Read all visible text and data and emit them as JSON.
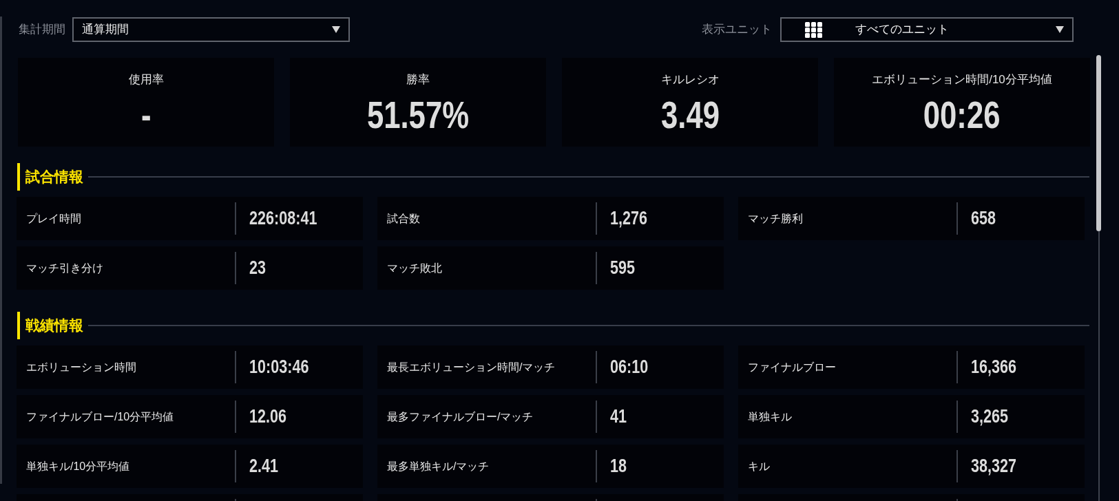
{
  "period_filter": {
    "label": "集計期間",
    "value": "通算期間"
  },
  "unit_filter": {
    "label": "表示ユニット",
    "value": "すべてのユニット"
  },
  "summary": [
    {
      "label": "使用率",
      "value": "-"
    },
    {
      "label": "勝率",
      "value": "51.57%"
    },
    {
      "label": "キルレシオ",
      "value": "3.49"
    },
    {
      "label": "エボリューション時間/10分平均値",
      "value": "00:26"
    }
  ],
  "sections": [
    {
      "title": "試合情報",
      "stats": [
        {
          "label": "プレイ時間",
          "value": "226:08:41"
        },
        {
          "label": "試合数",
          "value": "1,276"
        },
        {
          "label": "マッチ勝利",
          "value": "658"
        },
        {
          "label": "マッチ引き分け",
          "value": "23"
        },
        {
          "label": "マッチ敗北",
          "value": "595"
        }
      ]
    },
    {
      "title": "戦績情報",
      "stats": [
        {
          "label": "エボリューション時間",
          "value": "10:03:46"
        },
        {
          "label": "最長エボリューション時間/マッチ",
          "value": "06:10"
        },
        {
          "label": "ファイナルブロー",
          "value": "16,366"
        },
        {
          "label": "ファイナルブロー/10分平均値",
          "value": "12.06"
        },
        {
          "label": "最多ファイナルブロー/マッチ",
          "value": "41"
        },
        {
          "label": "単独キル",
          "value": "3,265"
        },
        {
          "label": "単独キル/10分平均値",
          "value": "2.41"
        },
        {
          "label": "最多単独キル/マッチ",
          "value": "18"
        },
        {
          "label": "キル",
          "value": "38,327"
        }
      ],
      "more_below": true
    }
  ]
}
